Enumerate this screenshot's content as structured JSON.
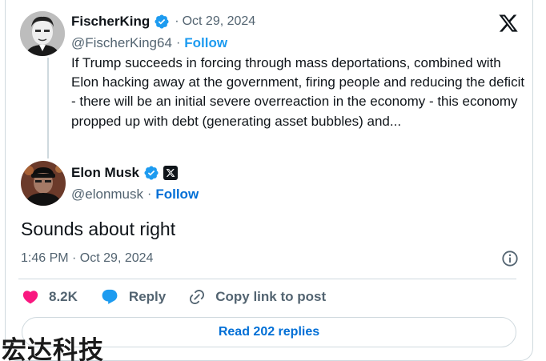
{
  "parent_tweet": {
    "display_name": "FischerKing",
    "date": "Oct 29, 2024",
    "handle": "@FischerKing64",
    "follow_label": "Follow",
    "text": "If Trump succeeds in forcing through mass deportations, combined with Elon hacking away at the government, firing people and reducing the deficit - there will be an initial severe overreaction in the economy - this economy propped up with debt (generating asset bubbles) and..."
  },
  "reply_tweet": {
    "display_name": "Elon Musk",
    "handle": "@elonmusk",
    "follow_label": "Follow",
    "text": "Sounds about right",
    "timestamp": "1:46 PM · Oct 29, 2024"
  },
  "actions": {
    "like_count": "8.2K",
    "reply_label": "Reply",
    "copy_link_label": "Copy link to post"
  },
  "read_replies_label": "Read 202 replies",
  "watermark": "宏达科技",
  "icons": [
    "x-logo-icon",
    "verified-badge-icon",
    "x-affiliate-badge-icon",
    "info-icon",
    "heart-icon",
    "reply-bubble-icon",
    "link-icon"
  ],
  "colors": {
    "accent_blue": "#1d9bf0",
    "link_blue": "#006fd6",
    "like_pink": "#f91880",
    "text_primary": "#0f1419",
    "text_secondary": "#536471",
    "border": "#cfd9de"
  }
}
